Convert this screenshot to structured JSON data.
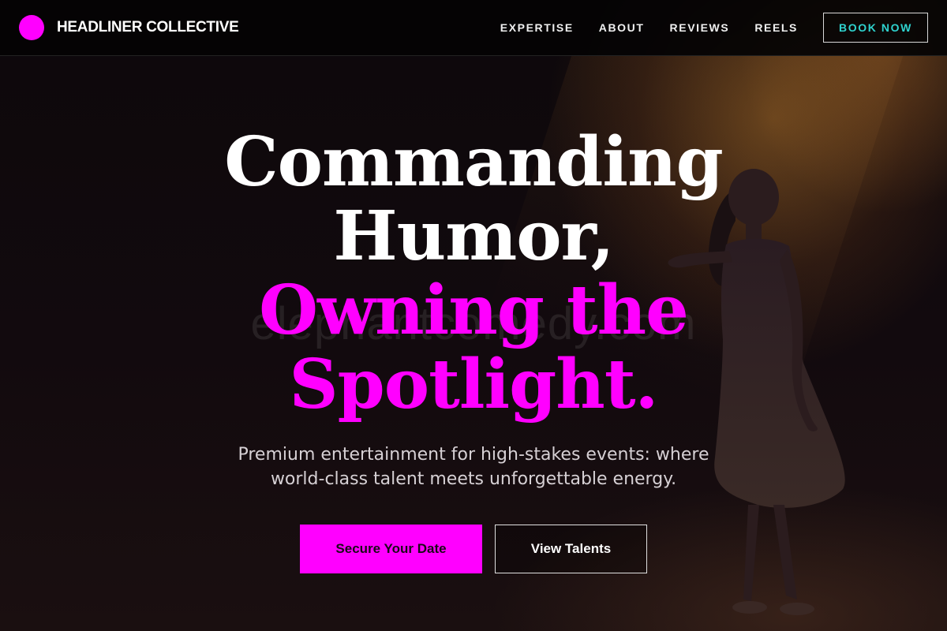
{
  "header": {
    "brand": "HEADLINER COLLECTIVE",
    "nav": [
      {
        "label": "EXPERTISE"
      },
      {
        "label": "ABOUT"
      },
      {
        "label": "REVIEWS"
      },
      {
        "label": "REELS"
      }
    ],
    "cta": "BOOK NOW"
  },
  "hero": {
    "watermark": "elephantcomedy.com",
    "headline_line1": "Commanding",
    "headline_line2": "Humor,",
    "headline_line3": "Owning the",
    "headline_line4": "Spotlight.",
    "subtitle": "Premium entertainment for high-stakes events: where world-class talent meets unforgettable energy.",
    "primary_button": "Secure Your Date",
    "secondary_button": "View Talents"
  },
  "colors": {
    "accent": "#ff00ff",
    "book_now_text": "#2fd3cf",
    "background": "#0b0709"
  }
}
